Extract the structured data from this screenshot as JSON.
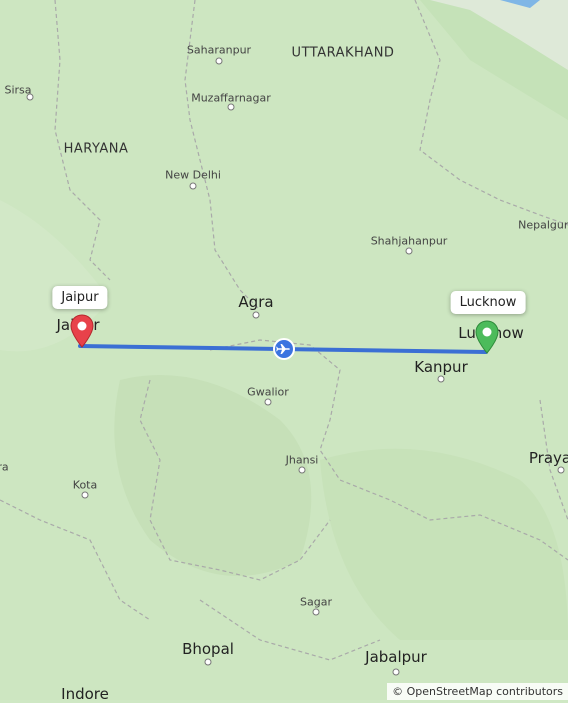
{
  "map": {
    "states": {
      "uttarakhand": "UTTARAKHAND",
      "haryana": "HARYANA"
    },
    "cities": {
      "saharanpur": "Saharanpur",
      "sirsa": "Sirsa",
      "muzaffarnagar": "Muzaffarnagar",
      "new_delhi": "New Delhi",
      "shahjahanpur": "Shahjahanpur",
      "nepalgunj": "Nepalgunj",
      "agra": "Agra",
      "jaipur": "Jaipur",
      "lucknow": "Lucknow",
      "kanpur": "Kanpur",
      "gwalior": "Gwalior",
      "jhansi": "Jhansi",
      "prayagraj": "Praya",
      "kota": "Kota",
      "sagar": "Sagar",
      "bhopal": "Bhopal",
      "jabalpur": "Jabalpur",
      "indore": "Indore",
      "edge_left": "ra"
    },
    "route": {
      "origin": "Jaipur",
      "destination": "Lucknow",
      "mode_icon": "airplane-icon",
      "line_color": "#3b6fd4",
      "origin_pin_color": "#e8424a",
      "destination_pin_color": "#4cbb5b"
    },
    "attribution": "© OpenStreetMap contributors"
  }
}
